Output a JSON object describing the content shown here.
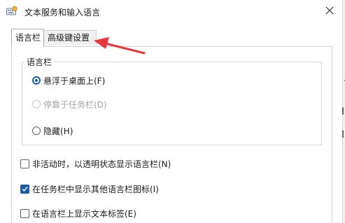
{
  "window": {
    "title": "文本服务和输入语言",
    "app_icon": "keyboard-globe-icon",
    "close_icon": "close-icon"
  },
  "tabs": [
    {
      "label": "语言栏",
      "active": true
    },
    {
      "label": "高级键设置",
      "active": false
    }
  ],
  "language_bar_group": {
    "legend": "语言栏",
    "options": [
      {
        "label": "悬浮于桌面上(F)",
        "checked": true,
        "disabled": false
      },
      {
        "label": "停靠于任务栏(D)",
        "checked": false,
        "disabled": true
      },
      {
        "label": "隐藏(H)",
        "checked": false,
        "disabled": false
      }
    ]
  },
  "checkboxes": [
    {
      "label": "非活动时，以透明状态显示语言栏(N)",
      "checked": false
    },
    {
      "label": "在任务栏中显示其他语言栏图标(I)",
      "checked": true
    },
    {
      "label": "在语言栏上显示文本标签(E)",
      "checked": false
    }
  ],
  "annotation": {
    "arrow_color": "#e8383d",
    "points_to": "高级键设置"
  },
  "colors": {
    "accent": "#1d5ba8",
    "disabled_text": "#a3a3a3"
  }
}
